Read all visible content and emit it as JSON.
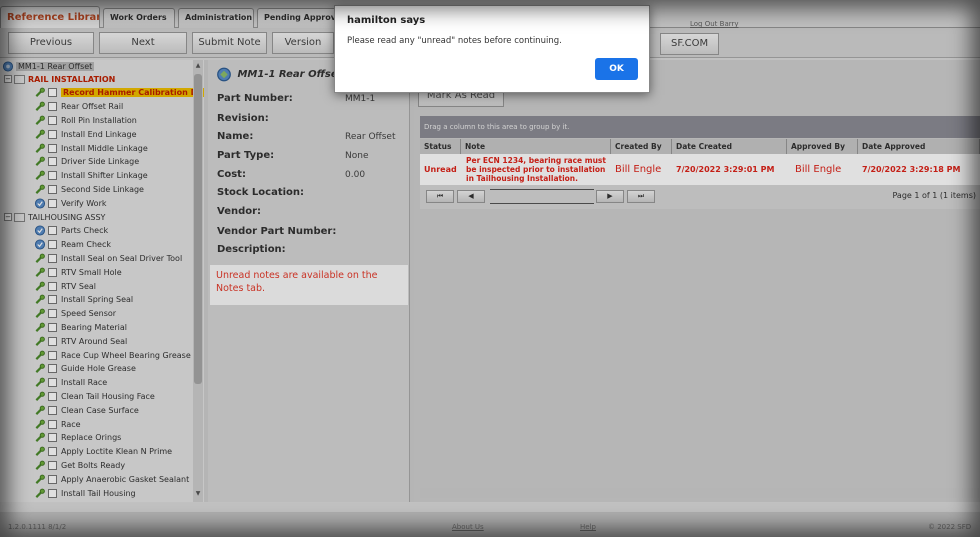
{
  "tabs": [
    "Reference Library",
    "Work Orders",
    "Administration",
    "Pending Approvals"
  ],
  "logout_label": "Log Out Barry",
  "toolbar": {
    "previous_label": "Previous",
    "next_label": "Next",
    "submit_note_label": "Submit Note",
    "version_label": "Version",
    "sfcom_label": "SF.COM"
  },
  "tree": {
    "root": "MM1-1 Rear Offset",
    "groups": [
      {
        "label": "RAIL INSTALLATION",
        "items": [
          {
            "label": "Record Hammer Calibration Da",
            "icon": "wrench-icon",
            "selected": true
          },
          {
            "label": "Rear Offset Rail",
            "icon": "wrench-icon"
          },
          {
            "label": "Roll Pin Installation",
            "icon": "wrench-icon"
          },
          {
            "label": "Install End Linkage",
            "icon": "wrench-icon"
          },
          {
            "label": "Install Middle Linkage",
            "icon": "wrench-icon"
          },
          {
            "label": "Driver Side Linkage",
            "icon": "wrench-icon"
          },
          {
            "label": "Install Shifter Linkage",
            "icon": "wrench-icon"
          },
          {
            "label": "Second Side Linkage",
            "icon": "wrench-icon"
          },
          {
            "label": "Verify Work",
            "icon": "check-circle-icon"
          }
        ]
      },
      {
        "label": "TAILHOUSING ASSY",
        "items": [
          {
            "label": "Parts Check",
            "icon": "check-circle-icon"
          },
          {
            "label": "Ream Check",
            "icon": "check-circle-icon"
          },
          {
            "label": "Install Seal on Seal Driver Tool",
            "icon": "wrench-icon"
          },
          {
            "label": "RTV Small Hole",
            "icon": "wrench-icon"
          },
          {
            "label": "RTV Seal",
            "icon": "wrench-icon"
          },
          {
            "label": "Install Spring Seal",
            "icon": "wrench-icon"
          },
          {
            "label": "Speed Sensor",
            "icon": "wrench-icon"
          },
          {
            "label": "Bearing Material",
            "icon": "wrench-icon"
          },
          {
            "label": "RTV Around Seal",
            "icon": "wrench-icon"
          },
          {
            "label": "Race Cup Wheel Bearing Grease",
            "icon": "wrench-icon"
          },
          {
            "label": "Guide Hole Grease",
            "icon": "wrench-icon"
          },
          {
            "label": "Install Race",
            "icon": "wrench-icon"
          },
          {
            "label": "Clean Tail Housing Face",
            "icon": "wrench-icon"
          },
          {
            "label": "Clean Case Surface",
            "icon": "wrench-icon"
          },
          {
            "label": "Race",
            "icon": "wrench-icon"
          },
          {
            "label": "Replace Orings",
            "icon": "wrench-icon"
          },
          {
            "label": "Apply Loctite Klean N Prime",
            "icon": "wrench-icon"
          },
          {
            "label": "Get Bolts Ready",
            "icon": "wrench-icon"
          },
          {
            "label": "Apply Anaerobic Gasket Sealant",
            "icon": "wrench-icon"
          },
          {
            "label": "Install Tail Housing",
            "icon": "wrench-icon"
          }
        ]
      }
    ]
  },
  "detail": {
    "title": "MM1-1 Rear Offset",
    "fields": [
      {
        "label": "Part Number:",
        "value": "MM1-1"
      },
      {
        "label": "Revision:",
        "value": ""
      },
      {
        "label": "Name:",
        "value": "Rear Offset"
      },
      {
        "label": "Part Type:",
        "value": "None"
      },
      {
        "label": "Cost:",
        "value": "0.00"
      },
      {
        "label": "Stock Location:",
        "value": ""
      },
      {
        "label": "Vendor:",
        "value": ""
      },
      {
        "label": "Vendor Part Number:",
        "value": ""
      },
      {
        "label": "Description:",
        "value": ""
      }
    ],
    "notice": "Unread notes are available on the Notes tab."
  },
  "notes_grid": {
    "mark_as_read_label": "Mark As Read",
    "group_hint": "Drag a column to this area to group by it.",
    "columns": [
      "Status",
      "Note",
      "Created By",
      "Date Created",
      "Approved By",
      "Date Approved"
    ],
    "rows": [
      {
        "status": "Unread",
        "note": "Per ECN 1234, bearing race must be inspected prior to installation in Tailhousing Installation.",
        "created_by": "Bill Engle",
        "date_created": "7/20/2022 3:29:01 PM",
        "approved_by": "Bill Engle",
        "date_approved": "7/20/2022 3:29:18 PM"
      }
    ],
    "pager": {
      "text": "Page 1 of 1 (1 items)"
    }
  },
  "footer": {
    "left": "1.2.0.1111 8/1/2",
    "about": "About Us",
    "help": "Help",
    "right": "© 2022 SFD"
  },
  "dialog": {
    "title": "hamilton says",
    "message": "Please read any \"unread\" notes before continuing.",
    "ok_label": "OK"
  },
  "colors": {
    "accent_red": "#e0241a",
    "selected_bg": "#f0c000",
    "ok_blue": "#1a73e8"
  }
}
